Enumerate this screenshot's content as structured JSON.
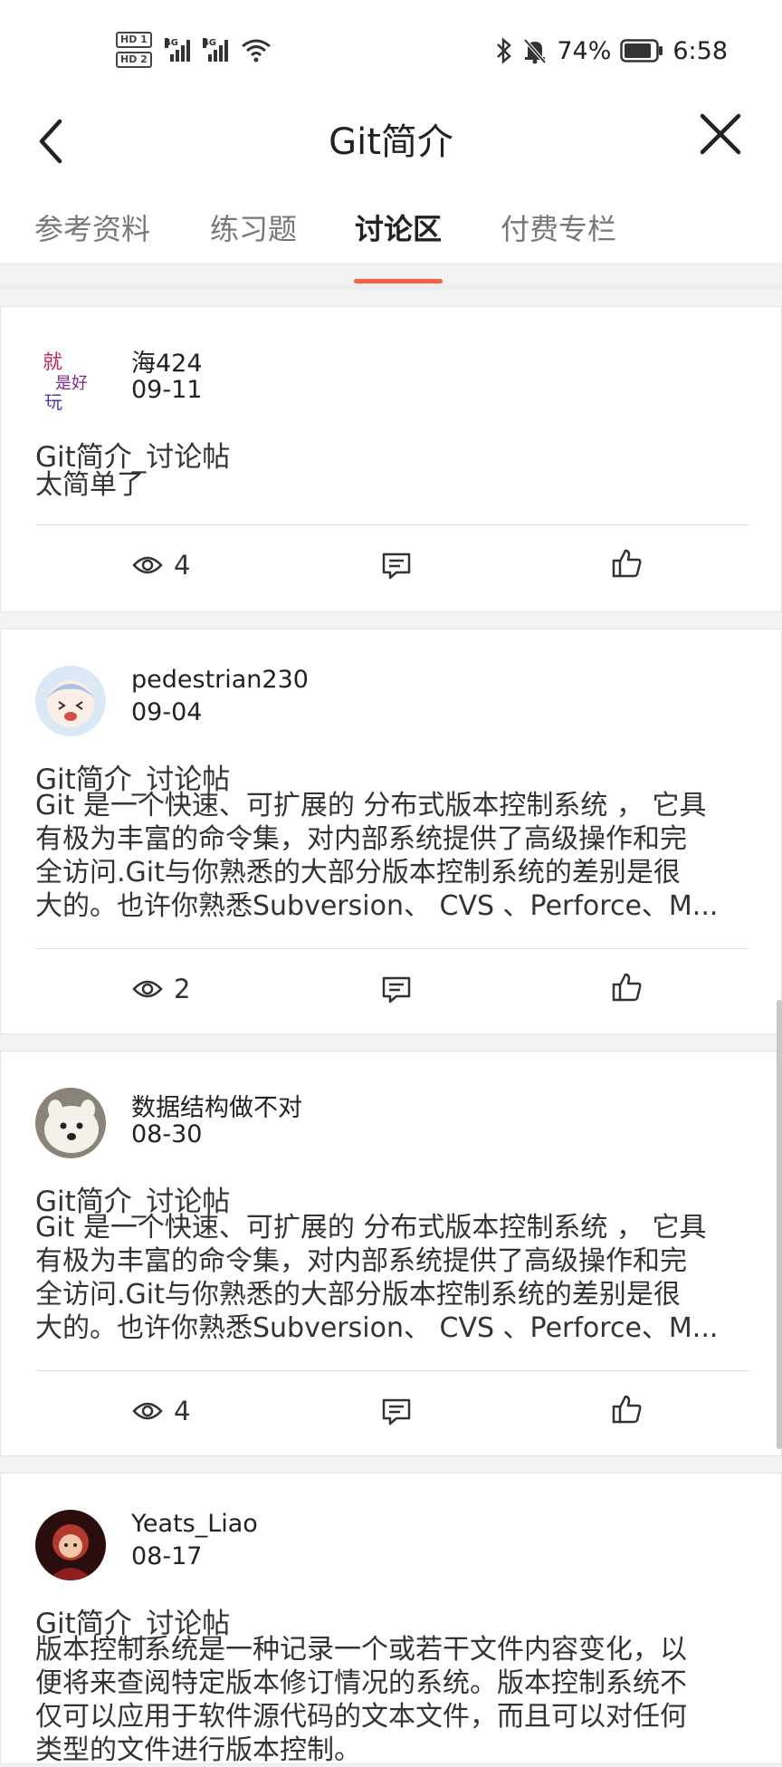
{
  "status": {
    "hd1": "HD 1",
    "hd2": "HD 2",
    "net1": "4G",
    "net2": "4G",
    "battery": "74%",
    "time": "6:58"
  },
  "header": {
    "title": "Git简介",
    "tabs": [
      "参考资料",
      "练习题",
      "讨论区",
      "付费专栏"
    ],
    "active_tab": "讨论区"
  },
  "posts": [
    {
      "user": "海424",
      "date": "09-11",
      "title": "Git简介_讨论帖",
      "body": "太简单了",
      "views": "4"
    },
    {
      "user": "pedestrian230",
      "date": "09-04",
      "title": "Git简介_讨论帖",
      "body": "Git 是一个快速、可扩展的 分布式版本控制系统 ， 它具\n有极为丰富的命令集，对内部系统提供了高级操作和完\n全访问.Git与你熟悉的大部分版本控制系统的差别是很\n大的。也许你熟悉Subversion、 CVS 、Perforce、M...",
      "views": "2"
    },
    {
      "user": "数据结构做不对",
      "date": "08-30",
      "title": "Git简介_讨论帖",
      "body": "Git 是一个快速、可扩展的 分布式版本控制系统 ， 它具\n有极为丰富的命令集，对内部系统提供了高级操作和完\n全访问.Git与你熟悉的大部分版本控制系统的差别是很\n大的。也许你熟悉Subversion、 CVS 、Perforce、M...",
      "views": "4"
    },
    {
      "user": "Yeats_Liao",
      "date": "08-17",
      "title": "Git简介_讨论帖",
      "body": "版本控制系统是一种记录一个或若干文件内容变化，以\n便将来查阅特定版本修订情况的系统。版本控制系统不\n仅可以应用于软件源代码的文本文件，而且可以对任何\n类型的文件进行版本控制。"
    }
  ],
  "icons": {
    "views": "eye-icon",
    "comment": "comment-icon",
    "like": "thumbs-up-icon"
  },
  "colors": {
    "accent": "#f4613e"
  }
}
